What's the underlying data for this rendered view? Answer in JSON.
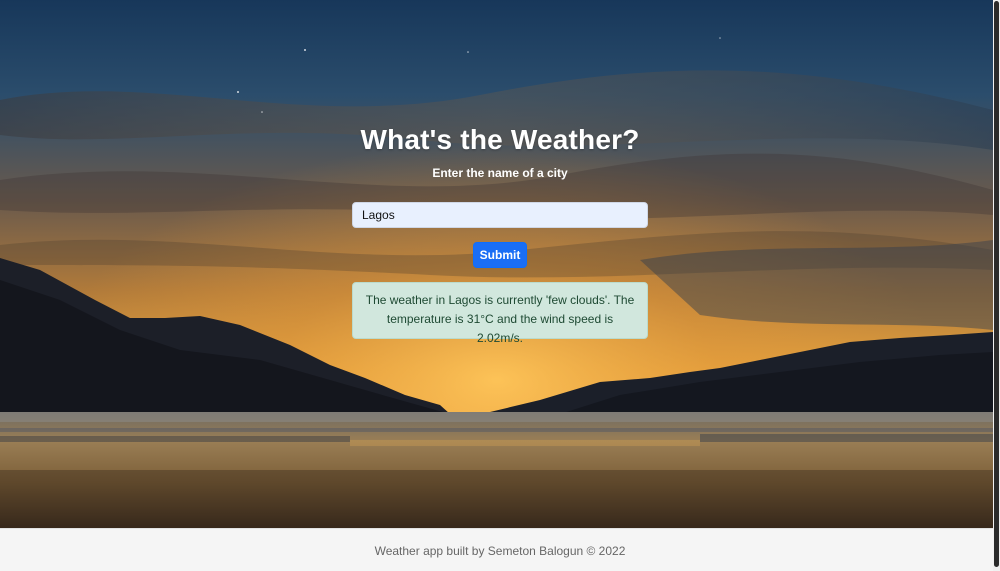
{
  "hero": {
    "title": "What's the Weather?",
    "subtitle": "Enter the name of a city"
  },
  "search": {
    "value": "Lagos"
  },
  "submit": {
    "label": "Submit"
  },
  "result": {
    "message": "The weather in Lagos is currently 'few clouds'. The temperature is 31°C and the wind speed is 2.02m/s."
  },
  "footer": {
    "text": "Weather app built by Semeton Balogun © 2022"
  },
  "colors": {
    "submit_button": "#1a6ef5",
    "result_background": "#d1e7dd",
    "input_background": "#e8f0fe"
  },
  "icons": {
    "background": "sunset-lake-landscape-image"
  }
}
